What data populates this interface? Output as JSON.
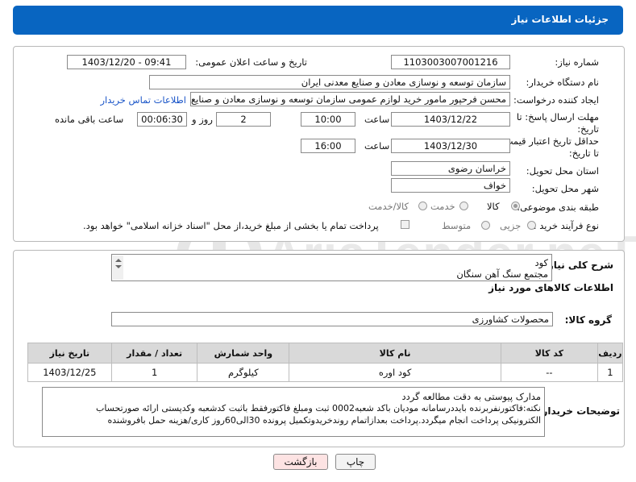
{
  "header": {
    "title": "جزئیات اطلاعات نیاز"
  },
  "fields": {
    "need_number_label": "شماره نیاز:",
    "need_number": "1103003007001216",
    "announce_label": "تاریخ و ساعت اعلان عمومی:",
    "announce_value": "1403/12/20 - 09:41",
    "buyer_org_label": "نام دستگاه خریدار:",
    "buyer_org": "سازمان توسعه و نوسازی معادن و صنایع معدنی ایران",
    "creator_label": "ایجاد کننده درخواست:",
    "creator": "محسن فرحپور مامور خرید لوازم عمومی سازمان توسعه و نوسازی معادن و صنایع",
    "contact_link": "اطلاعات تماس خریدار",
    "deadline_label": "مهلت ارسال پاسخ: تا تاریخ:",
    "deadline_date": "1403/12/22",
    "time_label": "ساعت",
    "deadline_time": "10:00",
    "days_value": "2",
    "days_label": "روز و",
    "remaining_time": "00:06:30",
    "remaining_label": "ساعت باقی مانده",
    "validity_label": "حداقل تاریخ اعتبار قیمت: تا تاریخ:",
    "validity_date": "1403/12/30",
    "validity_time": "16:00",
    "province_label": "استان محل تحویل:",
    "province": "خراسان رضوی",
    "city_label": "شهر محل تحویل:",
    "city": "خواف",
    "category_label": "طبقه بندی موضوعی:",
    "category_options": [
      "کالا",
      "خدمت",
      "کالا/خدمت"
    ],
    "category_selected": "کالا",
    "process_label": "نوع فرآیند خرید :",
    "process_options": [
      "جزیی",
      "متوسط"
    ],
    "payment_note": "پرداخت تمام یا بخشی از مبلغ خرید،از محل \"اسناد خزانه اسلامی\" خواهد بود."
  },
  "summary": {
    "label": "شرح کلی نیاز:",
    "text_line1": "کود",
    "text_line2": "مجتمع سنگ آهن سنگان"
  },
  "goods": {
    "section_title": "اطلاعات کالاهای مورد نیاز",
    "group_label": "گروه کالا:",
    "group_value": "محصولات کشاورزی",
    "table_headers": [
      "ردیف",
      "کد کالا",
      "نام کالا",
      "واحد شمارش",
      "تعداد / مقدار",
      "تاریخ نیاز"
    ],
    "rows": [
      {
        "row": "1",
        "code": "--",
        "name": "کود اوره",
        "unit": "کیلوگرم",
        "qty": "1",
        "date": "1403/12/25"
      }
    ]
  },
  "buyer_notes": {
    "label": "توضیحات خریدار:",
    "line1": "مدارک پیوستی به دقت مطالعه گردد",
    "line2": "نکته:فاکتورنفربرنده بایددرسامانه مودیان باکد شعبه0002 ثبت ومبلغ فاکتورفقط باثبت کدشعبه وکدپستی ارائه صورتحساب",
    "line3": "الکترونیکی پرداخت انجام میگردد.پرداخت بعدازاتمام روندخریدوتکمیل پرونده 30الی60روز کاری/هزینه حمل بافروشنده"
  },
  "buttons": {
    "print": "چاپ",
    "back": "بازگشت"
  },
  "watermark": "AriaTender.neT",
  "colors": {
    "header_bg": "#0865c1",
    "link": "#1a55c8",
    "back_button_bg": "#fde3e3"
  }
}
